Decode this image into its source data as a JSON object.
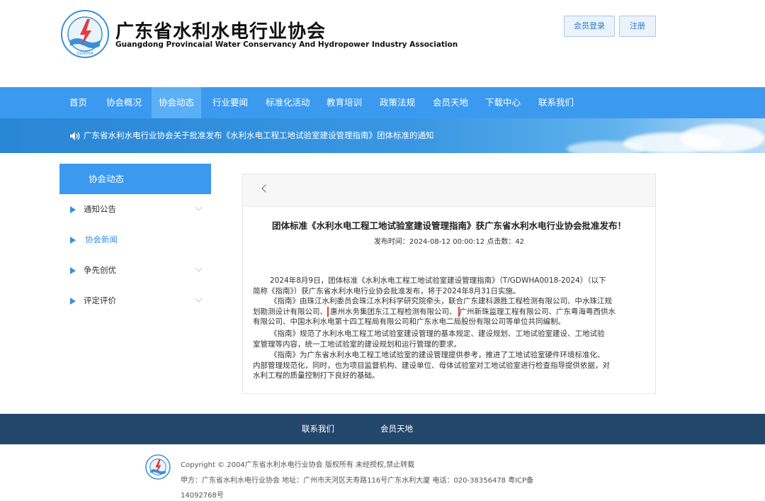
{
  "header": {
    "title": "广东省水利水电行业协会",
    "subtitle": "Guangdong Provincaial Water Conservancy And Hydropower Industry Association",
    "logo_text": "GDWHA",
    "login_label": "会员登录",
    "register_label": "注册"
  },
  "nav": [
    "首页",
    "协会概况",
    "协会动态",
    "行业要闻",
    "标准化活动",
    "教育培训",
    "政策法规",
    "会员天地",
    "下载中心",
    "联系我们"
  ],
  "banner": {
    "text": "广东省水利水电行业协会关于批准发布《水利水电工程工地试验室建设管理指南》团体标准的通知"
  },
  "sidebar": {
    "header": "协会动态",
    "items": [
      "通知公告",
      "协会新闻",
      "争先创优",
      "评定评价"
    ]
  },
  "article": {
    "title": "团体标准《水利水电工程工地试验室建设管理指南》获广东省水利水电行业协会批准发布！",
    "meta": "发布时间：2024-08-12 00:00:12  点击数：42",
    "p1_l1": "2024年8月9日，团体标准《水利水电工程工地试验室建设管理指南》（T/GDWHA0018-2024）（以下",
    "p1_l2": "简称《指南》）获广东省水利水电行业协会批准发布，将于2024年8月31日实施。",
    "p2_l1": "《指南》由珠江水利委员会珠江水利科学研究院牵头，联合广东建科源胜工程检测有限公司、中水珠江规",
    "p2_l2a": "划勘测设计有限公司、",
    "p2_l2b": "惠州水务集团东江工程检测有限公司、",
    "p2_l2c": "广州新珠监理工程有限公司、广东粤海粤西供水",
    "p2_l3": "有限公司、中国水利水电第十四工程局有限公司和广东水电二局股份有限公司等单位共同编制。",
    "p3_l1": "《指南》规范了水利水电工程工地试验室建设管理的基本规定、建设规划、工地试验室建设、工地试验",
    "p3_l2": "室管理等内容，统一工地试验室的建设规划和运行管理的要求。",
    "p4_l1": "《指南》为广东省水利水电工程工地试验室的建设管理提供参考，推进了工地试验室硬件环境标准化、",
    "p4_l2": "内部管理规范化，同时，也为项目监督机构、建设单位、母体试验室对工地试验室进行检查指导提供依据，对",
    "p4_l3": "水利工程的质量控制打下良好的基础。"
  },
  "footer": {
    "links": [
      "联系我们",
      "会员天地"
    ],
    "copyright": "Copyright © 2004广东省水利水电行业协会 版权所有 未经授权,禁止转载",
    "address": "甲方：广东省水利水电行业协会    地址：广州市天河区天寿路116号广东水利大厦    电话：020-38356478  粤ICP备",
    "icp": "14092768号"
  },
  "colors": {
    "nav_bg": "#3b9af0",
    "nav_active": "#5bb0f5",
    "footer_bg": "#23466b",
    "highlight_border": "#e03b3b"
  }
}
